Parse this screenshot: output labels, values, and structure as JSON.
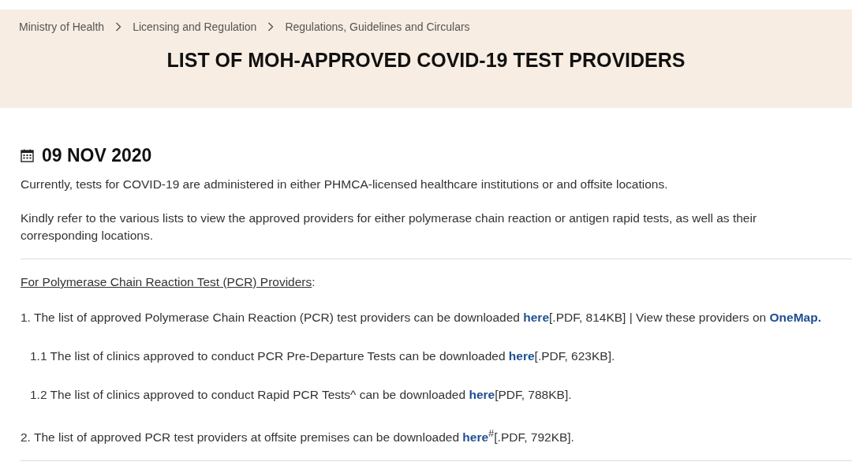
{
  "breadcrumb": [
    {
      "label": "Ministry of Health"
    },
    {
      "label": "Licensing and Regulation"
    },
    {
      "label": "Regulations, Guidelines and Circulars"
    }
  ],
  "page_title": "LIST OF MOH-APPROVED COVID-19 TEST PROVIDERS",
  "date": "09 NOV 2020",
  "paragraphs": [
    "Currently, tests for COVID-19 are administered in either PHMCA-licensed healthcare institutions or and offsite locations.",
    "Kindly refer to the various lists to view the approved providers for either polymerase chain reaction or antigen rapid tests, as well as their corresponding locations."
  ],
  "section": {
    "heading": "For Polymerase Chain Reaction Test (PCR) Providers",
    "heading_suffix": ":",
    "items": [
      {
        "parts": [
          {
            "kind": "text",
            "text": "1. The list of approved Polymerase Chain Reaction (PCR) test providers can be downloaded "
          },
          {
            "kind": "link",
            "text": "here"
          },
          {
            "kind": "text",
            "text": "[.PDF, 814KB] | View these providers on "
          },
          {
            "kind": "link",
            "text": "OneMap."
          }
        ],
        "children": [
          {
            "parts": [
              {
                "kind": "text",
                "text": "1.1 The list of clinics approved to conduct PCR Pre-Departure Tests can be downloaded "
              },
              {
                "kind": "link",
                "text": "here"
              },
              {
                "kind": "text",
                "text": "[.PDF, 623KB]."
              }
            ]
          },
          {
            "parts": [
              {
                "kind": "text",
                "text": "1.2 The list of clinics approved to conduct Rapid PCR Tests^ can be downloaded "
              },
              {
                "kind": "link",
                "text": "here"
              },
              {
                "kind": "text",
                "text": "[PDF, 788KB]."
              }
            ]
          }
        ]
      },
      {
        "parts": [
          {
            "kind": "text",
            "text": "2. The list of approved PCR test providers at offsite premises can be downloaded "
          },
          {
            "kind": "link",
            "text": "here"
          },
          {
            "kind": "text",
            "text": "$^{#}$[.PDF, 792KB]."
          }
        ]
      }
    ]
  }
}
